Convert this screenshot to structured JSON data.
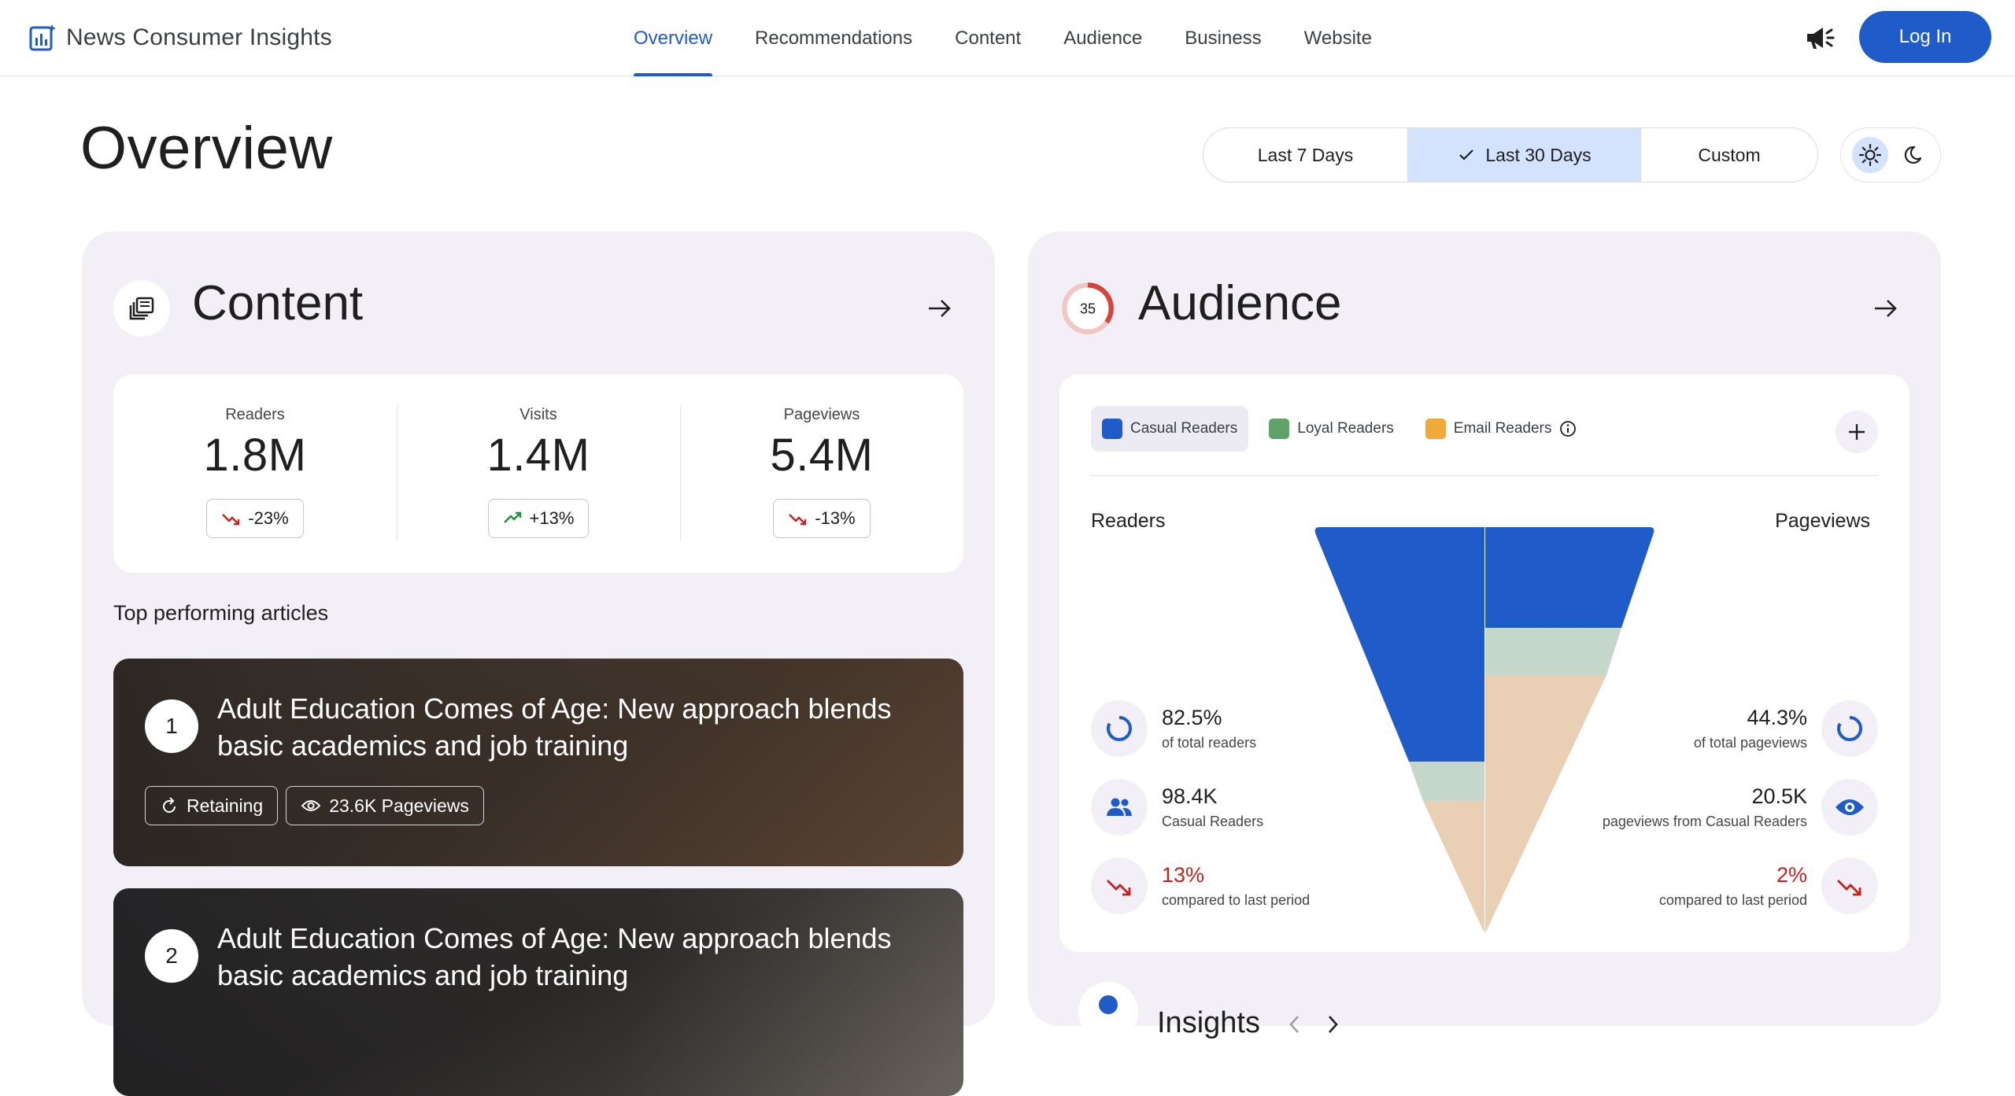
{
  "header": {
    "brand": "News Consumer Insights",
    "nav": [
      "Overview",
      "Recommendations",
      "Content",
      "Audience",
      "Business",
      "Website"
    ],
    "active_nav": "Overview",
    "login_label": "Log In"
  },
  "page": {
    "title": "Overview",
    "ranges": [
      "Last 7 Days",
      "Last 30 Days",
      "Custom"
    ],
    "selected_range": "Last 30 Days"
  },
  "content": {
    "title": "Content",
    "stats": [
      {
        "label": "Readers",
        "value": "1.8M",
        "change": "-23%",
        "trend": "down"
      },
      {
        "label": "Visits",
        "value": "1.4M",
        "change": "+13%",
        "trend": "up"
      },
      {
        "label": "Pageviews",
        "value": "5.4M",
        "change": "-13%",
        "trend": "down"
      }
    ],
    "top_label": "Top performing articles",
    "articles": [
      {
        "rank": "1",
        "title": "Adult Education Comes of Age: New approach blends basic academics and job training",
        "tag1": "Retaining",
        "tag2": "23.6K Pageviews"
      },
      {
        "rank": "2",
        "title": "Adult Education Comes of Age: New approach blends basic academics and job training",
        "tag1": "",
        "tag2": ""
      }
    ]
  },
  "audience": {
    "title": "Audience",
    "score": "35",
    "legend": [
      {
        "label": "Casual Readers",
        "color": "#1f5cc9"
      },
      {
        "label": "Loyal Readers",
        "color": "#5fa368"
      },
      {
        "label": "Email Readers",
        "color": "#f0a93b"
      }
    ],
    "readers_label": "Readers",
    "pageviews_label": "Pageviews",
    "left_metrics": [
      {
        "value": "82.5%",
        "sub": "of total readers"
      },
      {
        "value": "98.4K",
        "sub": "Casual Readers"
      },
      {
        "value": "13%",
        "sub": "compared to last period"
      }
    ],
    "right_metrics": [
      {
        "value": "44.3%",
        "sub": "of total pageviews"
      },
      {
        "value": "20.5K",
        "sub": "pageviews from Casual Readers"
      },
      {
        "value": "2%",
        "sub": "compared to last period"
      }
    ]
  },
  "insights": {
    "title": "Insights"
  }
}
